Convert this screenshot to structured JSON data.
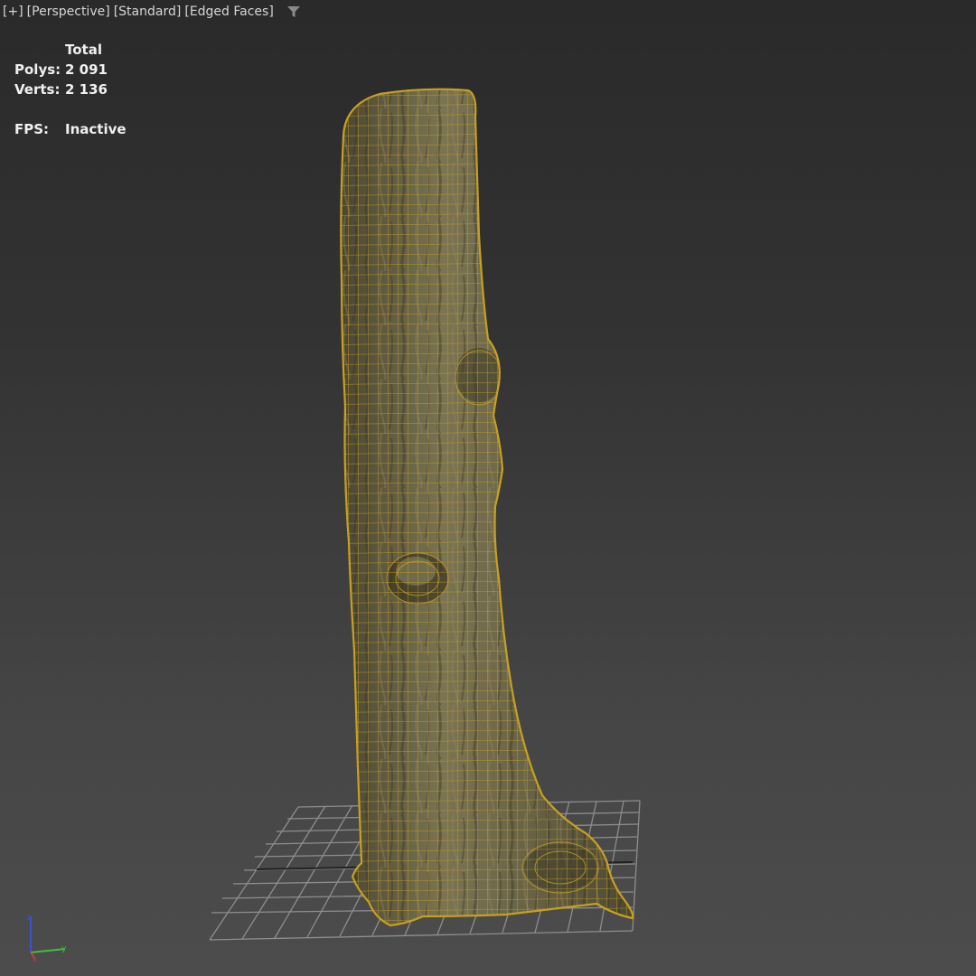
{
  "viewport": {
    "menus": [
      {
        "label": "+"
      },
      {
        "label": "Perspective"
      },
      {
        "label": "Standard"
      },
      {
        "label": "Edged Faces"
      }
    ],
    "filter_icon": "funnel-filter-icon"
  },
  "stats": {
    "header": "Total",
    "polys_label": "Polys:",
    "polys_value": "2 091",
    "verts_label": "Verts:",
    "verts_value": "2 136",
    "fps_label": "FPS:",
    "fps_value": "Inactive"
  },
  "scene": {
    "object": "tree-trunk-mesh",
    "wire_color": "#c8a020",
    "bark_color": "#6f6a4a",
    "grid_color": "#9a9a9a"
  },
  "gizmo": {
    "z_color": "#3a4fd8",
    "y_color": "#3fbf3f",
    "x_color": "#d83a3a"
  }
}
